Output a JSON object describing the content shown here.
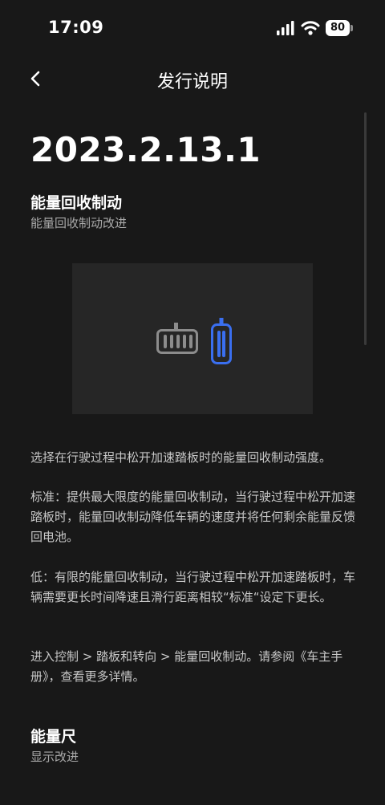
{
  "status_bar": {
    "time": "17:09",
    "battery": "80",
    "icons": [
      "signal-icon",
      "wifi-icon",
      "battery-icon"
    ]
  },
  "nav": {
    "title": "发行说明",
    "back_icon": "chevron-left-icon"
  },
  "version": "2023.2.13.1",
  "features": [
    {
      "title": "能量回收制动",
      "subtitle": "能量回收制动改进"
    },
    {
      "title": "能量尺",
      "subtitle": "显示改进"
    }
  ],
  "illustration": {
    "icons": [
      "brake-pedal-icon",
      "accelerator-pedal-icon"
    ],
    "accent": "#3a6ff0"
  },
  "paragraphs": [
    "选择在行驶过程中松开加速踏板时的能量回收制动强度。",
    "标准：提供最大限度的能量回收制动，当行驶过程中松开加速踏板时，能量回收制动降低车辆的速度并将任何剩余能量反馈回电池。",
    "低：有限的能量回收制动，当行驶过程中松开加速踏板时，车辆需要更长时间降速且滑行距离相较“标准“设定下更长。",
    "进入控制 > 踏板和转向 > 能量回收制动。请参阅《车主手册》，查看更多详情。"
  ],
  "colors": {
    "background": "#181818",
    "accent": "#3a6ff0"
  }
}
